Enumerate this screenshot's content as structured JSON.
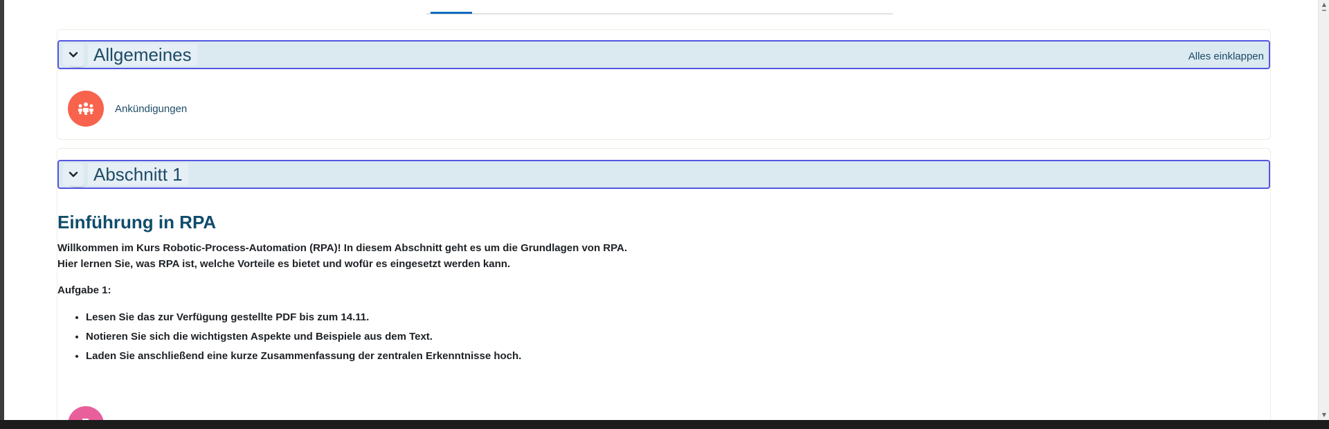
{
  "page": {
    "tab_nav": {
      "active_index": 0
    }
  },
  "sections": {
    "general": {
      "title": "Allgemeines",
      "collapse_all": "Alles einklappen",
      "activities": [
        {
          "label": "Ankündigungen",
          "icon": "forum-people-icon",
          "color": "#f7634d"
        }
      ]
    },
    "section1": {
      "title": "Abschnitt 1",
      "heading": "Einführung in RPA",
      "intro_lines": [
        "Willkommen im Kurs Robotic-Process-Automation (RPA)! In diesem Abschnitt geht es um die Grundlagen von RPA.",
        "Hier lernen Sie, was RPA ist, welche Vorteile es bietet und wofür es eingesetzt werden kann."
      ],
      "task_label": "Aufgabe 1:",
      "tasks": [
        "Lesen Sie das zur Verfügung gestellte PDF bis zum 14.11.",
        "Notieren Sie sich die wichtigsten Aspekte und Beispiele aus dem Text.",
        "Laden Sie anschließend eine kurze Zusammenfassung der zentralen Erkenntnisse hoch."
      ],
      "next_activity": {
        "icon": "assignment-icon",
        "color": "#e95f9c"
      }
    }
  },
  "colors": {
    "header_bg": "#dbe9f1",
    "header_border": "#5257e0",
    "link": "#1d4b67",
    "heading": "#0f4c6b",
    "active_tab": "#0f6cbf"
  }
}
